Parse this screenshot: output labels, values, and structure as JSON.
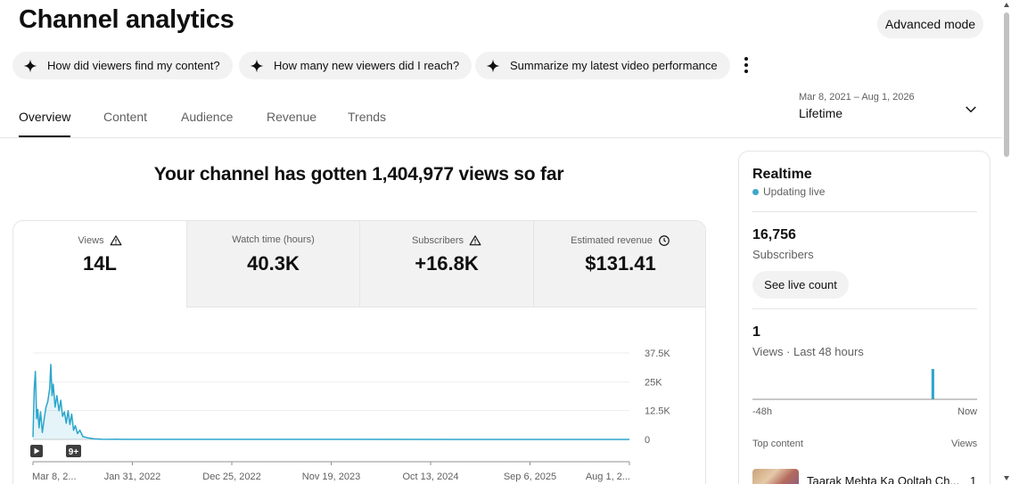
{
  "header": {
    "title": "Channel analytics",
    "advanced_mode_label": "Advanced mode"
  },
  "chips": [
    {
      "label": "How did viewers find my content?",
      "icon": "sparkle-icon"
    },
    {
      "label": "How many new viewers did I reach?",
      "icon": "sparkle-icon"
    },
    {
      "label": "Summarize my latest video performance",
      "icon": "sparkle-icon"
    }
  ],
  "tabs": [
    {
      "label": "Overview",
      "active": true
    },
    {
      "label": "Content",
      "active": false
    },
    {
      "label": "Audience",
      "active": false
    },
    {
      "label": "Revenue",
      "active": false
    },
    {
      "label": "Trends",
      "active": false
    }
  ],
  "date_selector": {
    "range": "Mar 8, 2021 – Aug 1, 2026",
    "label": "Lifetime"
  },
  "headline": "Your channel has gotten 1,404,977 views so far",
  "metrics": [
    {
      "label": "Views",
      "value": "14L",
      "icon": "warning-icon",
      "active": true
    },
    {
      "label": "Watch time (hours)",
      "value": "40.3K",
      "icon": "",
      "active": false
    },
    {
      "label": "Subscribers",
      "value": "+16.8K",
      "icon": "warning-icon",
      "active": false
    },
    {
      "label": "Estimated revenue",
      "value": "$131.41",
      "icon": "clock-icon",
      "active": false
    }
  ],
  "colors": {
    "accent": "#2ba6cb",
    "live_dot": "#3ea6c9"
  },
  "chart_data": {
    "type": "area",
    "title": "",
    "xlabel": "",
    "ylabel": "",
    "x_tick_labels": [
      "Mar 8, 2...",
      "Jan 31, 2022",
      "Dec 25, 2022",
      "Nov 19, 2023",
      "Oct 13, 2024",
      "Sep 6, 2025",
      "Aug 1, 2..."
    ],
    "y_tick_labels": [
      "37.5K",
      "25K",
      "12.5K",
      "0"
    ],
    "y_ticks": [
      37500,
      25000,
      12500,
      0
    ],
    "ylim": [
      0,
      37500
    ],
    "xlim": [
      "2021-03-08",
      "2026-08-01"
    ],
    "grid": true,
    "series": [
      {
        "values": [
          [
            "2021-03-08",
            1000
          ],
          [
            "2021-03-12",
            22000
          ],
          [
            "2021-03-16",
            29500
          ],
          [
            "2021-03-20",
            9000
          ],
          [
            "2021-03-24",
            13000
          ],
          [
            "2021-03-28",
            5000
          ],
          [
            "2021-04-02",
            12000
          ],
          [
            "2021-04-08",
            3000
          ],
          [
            "2021-04-14",
            9000
          ],
          [
            "2021-04-20",
            14000
          ],
          [
            "2021-04-26",
            16500
          ],
          [
            "2021-05-02",
            22000
          ],
          [
            "2021-05-06",
            32500
          ],
          [
            "2021-05-10",
            19000
          ],
          [
            "2021-05-14",
            24000
          ],
          [
            "2021-05-20",
            14000
          ],
          [
            "2021-05-26",
            19000
          ],
          [
            "2021-06-02",
            12500
          ],
          [
            "2021-06-08",
            17000
          ],
          [
            "2021-06-14",
            10000
          ],
          [
            "2021-06-20",
            12000
          ],
          [
            "2021-06-26",
            7000
          ],
          [
            "2021-07-02",
            12500
          ],
          [
            "2021-07-08",
            6500
          ],
          [
            "2021-07-14",
            11000
          ],
          [
            "2021-07-20",
            4000
          ],
          [
            "2021-07-26",
            6000
          ],
          [
            "2021-08-02",
            2500
          ],
          [
            "2021-08-10",
            4000
          ],
          [
            "2021-08-20",
            1200
          ],
          [
            "2021-09-05",
            700
          ],
          [
            "2021-09-25",
            300
          ],
          [
            "2021-10-20",
            120
          ],
          [
            "2022-01-01",
            50
          ],
          [
            "2023-06-01",
            20
          ],
          [
            "2026-08-01",
            0
          ]
        ]
      }
    ],
    "markers": [
      {
        "label": "",
        "icon": "play-icon"
      },
      {
        "label": "9+",
        "icon": ""
      }
    ]
  },
  "realtime": {
    "title": "Realtime",
    "status": "Updating live",
    "subscribers_value": "16,756",
    "subscribers_label": "Subscribers",
    "live_count_label": "See live count",
    "views_value": "1",
    "views_label": "Views · Last 48 hours",
    "axis_start": "-48h",
    "axis_end": "Now",
    "bars": [
      0,
      0,
      0,
      0,
      0,
      0,
      0,
      0,
      0,
      0,
      0,
      0,
      0,
      0,
      0,
      0,
      0,
      0,
      0,
      0,
      0,
      0,
      0,
      0,
      0,
      0,
      0,
      0,
      0,
      0,
      0,
      0,
      0,
      0,
      0,
      0,
      0,
      0,
      1,
      0,
      0,
      0,
      0,
      0,
      0,
      0,
      0,
      0
    ],
    "top_content_label": "Top content",
    "views_col_label": "Views",
    "top_items": [
      {
        "title": "Taarak Mehta Ka Ooltah Ch...",
        "views": "1"
      }
    ]
  }
}
